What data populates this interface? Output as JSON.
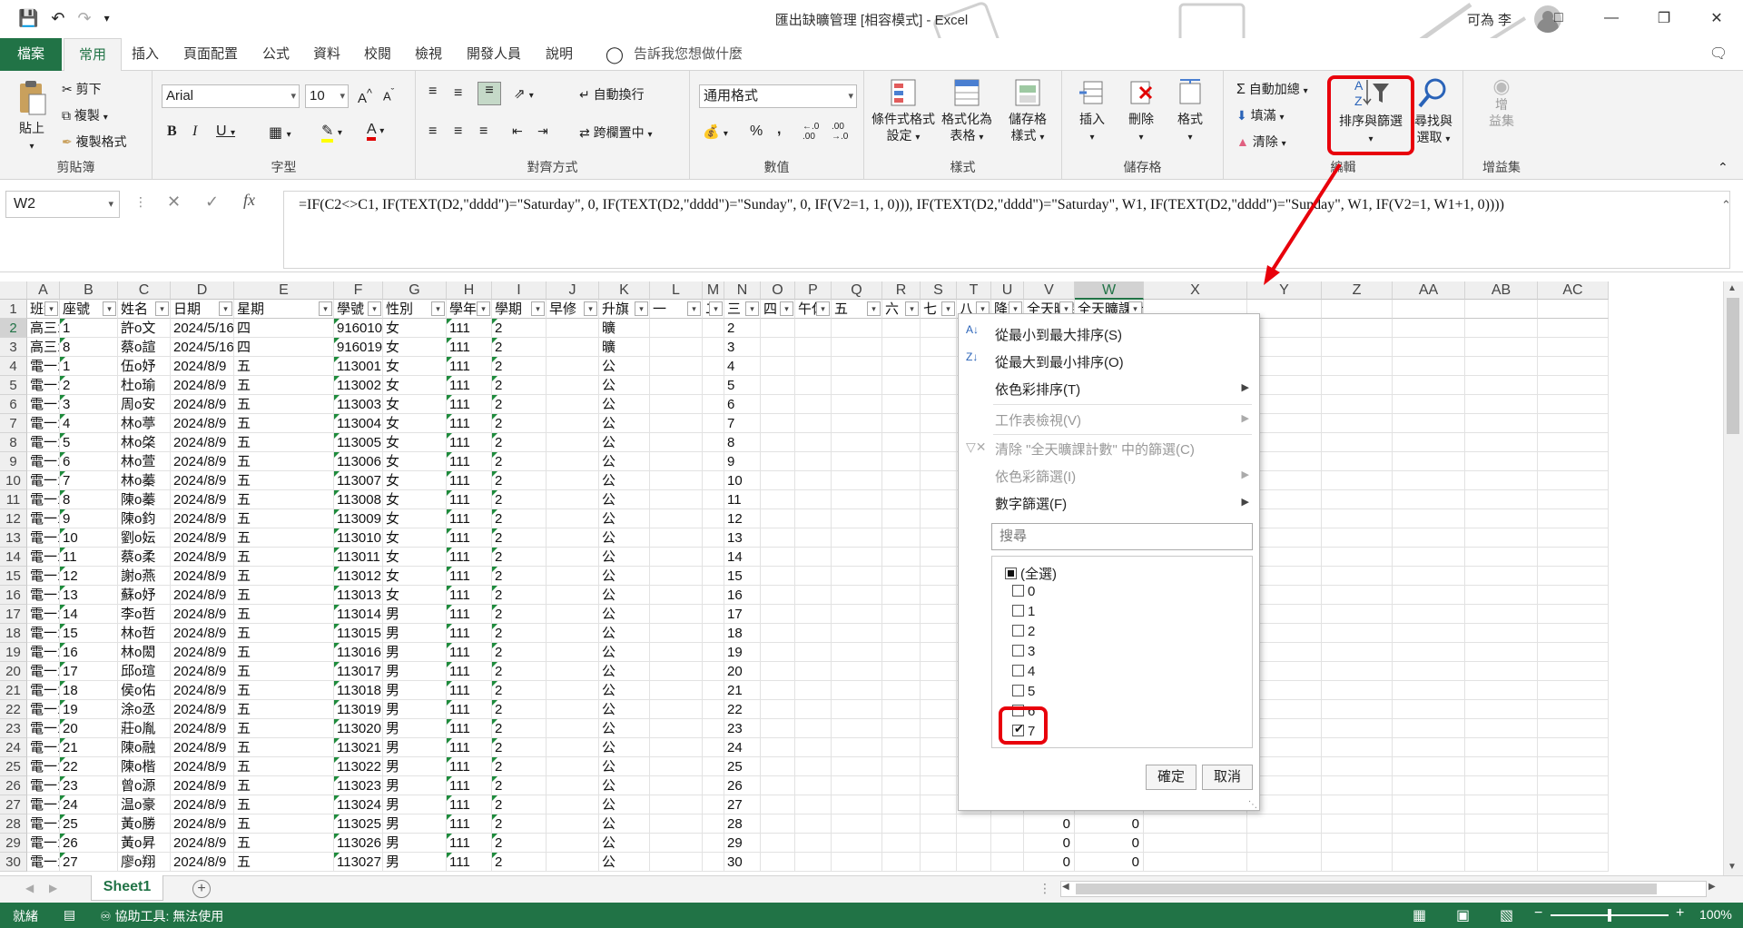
{
  "window": {
    "title": "匯出缺曠管理 [相容模式] - Excel",
    "user": "可為 李"
  },
  "tabs": [
    "檔案",
    "常用",
    "插入",
    "頁面配置",
    "公式",
    "資料",
    "校閱",
    "檢視",
    "開發人員",
    "說明"
  ],
  "tell_me": "告訴我您想做什麼",
  "ribbon": {
    "clipboard": {
      "paste": "貼上",
      "cut": "剪下",
      "copy": "複製",
      "format_painter": "複製格式",
      "label": "剪貼簿"
    },
    "font": {
      "name": "Arial",
      "size": "10",
      "label": "字型"
    },
    "alignment": {
      "wrap": "自動換行",
      "merge": "跨欄置中",
      "label": "對齊方式"
    },
    "number": {
      "format": "通用格式",
      "label": "數值"
    },
    "styles": {
      "conditional_1": "條件式格式",
      "conditional_2": "設定",
      "table_1": "格式化為",
      "table_2": "表格",
      "cell_1": "儲存格",
      "cell_2": "樣式",
      "label": "樣式"
    },
    "cells": {
      "insert": "插入",
      "delete": "刪除",
      "format": "格式",
      "label": "儲存格"
    },
    "editing": {
      "autosum": "自動加總",
      "fill": "填滿",
      "clear": "清除",
      "sort_1": "排序與篩選",
      "find_1": "尋找與",
      "find_2": "選取",
      "label": "編輯"
    },
    "addins": {
      "btn_1": "增",
      "btn_2": "益集",
      "label": "增益集"
    }
  },
  "formula_bar": {
    "name_box": "W2",
    "formula": "=IF(C2<>C1, IF(TEXT(D2,\"dddd\")=\"Saturday\", 0, IF(TEXT(D2,\"dddd\")=\"Sunday\", 0, IF(V2=1, 1, 0))), IF(TEXT(D2,\"dddd\")=\"Saturday\", W1, IF(TEXT(D2,\"dddd\")=\"Sunday\", W1, IF(V2=1, W1+1, 0))))"
  },
  "columns": [
    "A",
    "B",
    "C",
    "D",
    "E",
    "F",
    "G",
    "H",
    "I",
    "J",
    "K",
    "L",
    "M",
    "N",
    "O",
    "P",
    "Q",
    "R",
    "S",
    "T",
    "U",
    "V",
    "W",
    "X",
    "Y",
    "Z",
    "AA",
    "AB",
    "AC"
  ],
  "headers": [
    "班級",
    "座號",
    "姓名",
    "日期",
    "星期",
    "學號",
    "性別",
    "學年度",
    "學期",
    "早修",
    "升旗",
    "一",
    "二",
    "三",
    "四",
    "午休",
    "五",
    "六",
    "七",
    "八",
    "降旗",
    "全天曠課",
    "全天曠課計"
  ],
  "rows": [
    {
      "n": "2",
      "a": "高三1",
      "b": "1",
      "c": "許o文",
      "d": "2024/5/16",
      "e": "四",
      "f": "916010",
      "g": "女",
      "h": "111",
      "i": "2",
      "k": "曠"
    },
    {
      "n": "3",
      "a": "高三1",
      "b": "8",
      "c": "蔡o諠",
      "d": "2024/5/16",
      "e": "四",
      "f": "916019",
      "g": "女",
      "h": "111",
      "i": "2",
      "k": "曠"
    },
    {
      "n": "4",
      "a": "電一1",
      "b": "1",
      "c": "伍o妤",
      "d": "2024/8/9",
      "e": "五",
      "f": "113001",
      "g": "女",
      "h": "111",
      "i": "2",
      "k": "公"
    },
    {
      "n": "5",
      "a": "電一1",
      "b": "2",
      "c": "杜o瑜",
      "d": "2024/8/9",
      "e": "五",
      "f": "113002",
      "g": "女",
      "h": "111",
      "i": "2",
      "k": "公"
    },
    {
      "n": "6",
      "a": "電一1",
      "b": "3",
      "c": "周o安",
      "d": "2024/8/9",
      "e": "五",
      "f": "113003",
      "g": "女",
      "h": "111",
      "i": "2",
      "k": "公"
    },
    {
      "n": "7",
      "a": "電一1",
      "b": "4",
      "c": "林o葶",
      "d": "2024/8/9",
      "e": "五",
      "f": "113004",
      "g": "女",
      "h": "111",
      "i": "2",
      "k": "公"
    },
    {
      "n": "8",
      "a": "電一1",
      "b": "5",
      "c": "林o棨",
      "d": "2024/8/9",
      "e": "五",
      "f": "113005",
      "g": "女",
      "h": "111",
      "i": "2",
      "k": "公"
    },
    {
      "n": "9",
      "a": "電一1",
      "b": "6",
      "c": "林o萱",
      "d": "2024/8/9",
      "e": "五",
      "f": "113006",
      "g": "女",
      "h": "111",
      "i": "2",
      "k": "公"
    },
    {
      "n": "10",
      "a": "電一1",
      "b": "7",
      "c": "林o蓁",
      "d": "2024/8/9",
      "e": "五",
      "f": "113007",
      "g": "女",
      "h": "111",
      "i": "2",
      "k": "公"
    },
    {
      "n": "11",
      "a": "電一1",
      "b": "8",
      "c": "陳o蓁",
      "d": "2024/8/9",
      "e": "五",
      "f": "113008",
      "g": "女",
      "h": "111",
      "i": "2",
      "k": "公"
    },
    {
      "n": "12",
      "a": "電一1",
      "b": "9",
      "c": "陳o鈞",
      "d": "2024/8/9",
      "e": "五",
      "f": "113009",
      "g": "女",
      "h": "111",
      "i": "2",
      "k": "公"
    },
    {
      "n": "13",
      "a": "電一1",
      "b": "10",
      "c": "劉o妘",
      "d": "2024/8/9",
      "e": "五",
      "f": "113010",
      "g": "女",
      "h": "111",
      "i": "2",
      "k": "公"
    },
    {
      "n": "14",
      "a": "電一1",
      "b": "11",
      "c": "蔡o柔",
      "d": "2024/8/9",
      "e": "五",
      "f": "113011",
      "g": "女",
      "h": "111",
      "i": "2",
      "k": "公"
    },
    {
      "n": "15",
      "a": "電一1",
      "b": "12",
      "c": "謝o燕",
      "d": "2024/8/9",
      "e": "五",
      "f": "113012",
      "g": "女",
      "h": "111",
      "i": "2",
      "k": "公"
    },
    {
      "n": "16",
      "a": "電一1",
      "b": "13",
      "c": "蘇o妤",
      "d": "2024/8/9",
      "e": "五",
      "f": "113013",
      "g": "女",
      "h": "111",
      "i": "2",
      "k": "公"
    },
    {
      "n": "17",
      "a": "電一1",
      "b": "14",
      "c": "李o哲",
      "d": "2024/8/9",
      "e": "五",
      "f": "113014",
      "g": "男",
      "h": "111",
      "i": "2",
      "k": "公"
    },
    {
      "n": "18",
      "a": "電一1",
      "b": "15",
      "c": "林o哲",
      "d": "2024/8/9",
      "e": "五",
      "f": "113015",
      "g": "男",
      "h": "111",
      "i": "2",
      "k": "公"
    },
    {
      "n": "19",
      "a": "電一1",
      "b": "16",
      "c": "林o閎",
      "d": "2024/8/9",
      "e": "五",
      "f": "113016",
      "g": "男",
      "h": "111",
      "i": "2",
      "k": "公"
    },
    {
      "n": "20",
      "a": "電一1",
      "b": "17",
      "c": "邱o瑄",
      "d": "2024/8/9",
      "e": "五",
      "f": "113017",
      "g": "男",
      "h": "111",
      "i": "2",
      "k": "公"
    },
    {
      "n": "21",
      "a": "電一1",
      "b": "18",
      "c": "侯o佑",
      "d": "2024/8/9",
      "e": "五",
      "f": "113018",
      "g": "男",
      "h": "111",
      "i": "2",
      "k": "公"
    },
    {
      "n": "22",
      "a": "電一1",
      "b": "19",
      "c": "涂o丞",
      "d": "2024/8/9",
      "e": "五",
      "f": "113019",
      "g": "男",
      "h": "111",
      "i": "2",
      "k": "公"
    },
    {
      "n": "23",
      "a": "電一1",
      "b": "20",
      "c": "莊o胤",
      "d": "2024/8/9",
      "e": "五",
      "f": "113020",
      "g": "男",
      "h": "111",
      "i": "2",
      "k": "公"
    },
    {
      "n": "24",
      "a": "電一1",
      "b": "21",
      "c": "陳o融",
      "d": "2024/8/9",
      "e": "五",
      "f": "113021",
      "g": "男",
      "h": "111",
      "i": "2",
      "k": "公"
    },
    {
      "n": "25",
      "a": "電一1",
      "b": "22",
      "c": "陳o楷",
      "d": "2024/8/9",
      "e": "五",
      "f": "113022",
      "g": "男",
      "h": "111",
      "i": "2",
      "k": "公"
    },
    {
      "n": "26",
      "a": "電一1",
      "b": "23",
      "c": "曾o源",
      "d": "2024/8/9",
      "e": "五",
      "f": "113023",
      "g": "男",
      "h": "111",
      "i": "2",
      "k": "公"
    },
    {
      "n": "27",
      "a": "電一1",
      "b": "24",
      "c": "温o豪",
      "d": "2024/8/9",
      "e": "五",
      "f": "113024",
      "g": "男",
      "h": "111",
      "i": "2",
      "k": "公"
    },
    {
      "n": "28",
      "a": "電一1",
      "b": "25",
      "c": "黃o勝",
      "d": "2024/8/9",
      "e": "五",
      "f": "113025",
      "g": "男",
      "h": "111",
      "i": "2",
      "k": "公",
      "v": "0",
      "w": "0"
    },
    {
      "n": "29",
      "a": "電一1",
      "b": "26",
      "c": "黃o昇",
      "d": "2024/8/9",
      "e": "五",
      "f": "113026",
      "g": "男",
      "h": "111",
      "i": "2",
      "k": "公",
      "v": "0",
      "w": "0"
    },
    {
      "n": "30",
      "a": "電一1",
      "b": "27",
      "c": "廖o翔",
      "d": "2024/8/9",
      "e": "五",
      "f": "113027",
      "g": "男",
      "h": "111",
      "i": "2",
      "k": "公",
      "v": "0",
      "w": "0"
    }
  ],
  "filter_menu": {
    "sort_asc": "從最小到最大排序(S)",
    "sort_desc": "從最大到最小排序(O)",
    "sort_color": "依色彩排序(T)",
    "sheet_view": "工作表檢視(V)",
    "clear_filter": "清除 \"全天曠課計數\" 中的篩選(C)",
    "filter_color": "依色彩篩選(I)",
    "number_filter": "數字篩選(F)",
    "search_placeholder": "搜尋",
    "items": [
      {
        "label": "(全選)",
        "state": "partial"
      },
      {
        "label": "0",
        "state": "off"
      },
      {
        "label": "1",
        "state": "off"
      },
      {
        "label": "2",
        "state": "off"
      },
      {
        "label": "3",
        "state": "off"
      },
      {
        "label": "4",
        "state": "off"
      },
      {
        "label": "5",
        "state": "off"
      },
      {
        "label": "6",
        "state": "off"
      },
      {
        "label": "7",
        "state": "on"
      }
    ],
    "ok": "確定",
    "cancel": "取消"
  },
  "sheet_tab": "Sheet1",
  "status": {
    "ready": "就緒",
    "accessibility": "協助工具: 無法使用",
    "zoom": "100%"
  },
  "colors": {
    "excel_green": "#217346",
    "highlight": "#e8000b"
  }
}
